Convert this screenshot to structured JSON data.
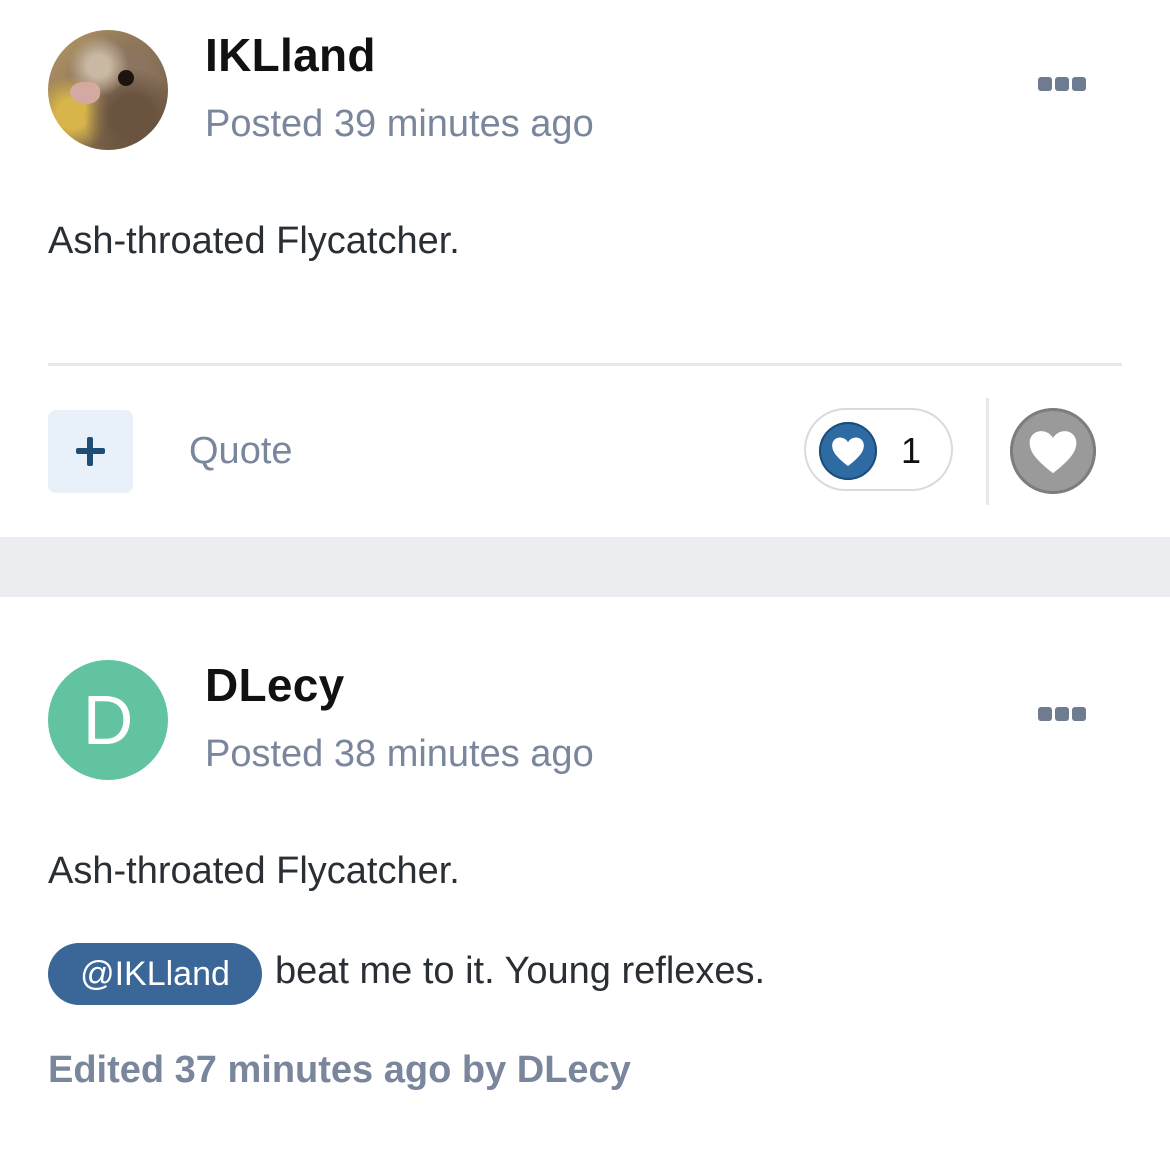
{
  "colors": {
    "accent": "#2d6ba2",
    "mention_bg": "#3a6797",
    "meta_text": "#7a869c",
    "avatar_letter_bg": "#62c3a0",
    "separator_bg": "#ebedf1"
  },
  "posts": [
    {
      "author": "IKLland",
      "posted": "Posted 39 minutes ago",
      "body": "Ash-throated Flycatcher.",
      "more_icon": "ellipsis-icon",
      "actions": {
        "add_icon": "plus-icon",
        "quote_label": "Quote",
        "reaction_icon": "heart-icon",
        "reaction_count": "1",
        "like_icon": "heart-outline-icon"
      }
    },
    {
      "author": "DLecy",
      "avatar_letter": "D",
      "posted": "Posted 38 minutes ago",
      "body": "Ash-throated Flycatcher.",
      "mention": "@IKLland",
      "mention_text": "beat me to it. Young reflexes.",
      "edited": "Edited 37 minutes ago by DLecy",
      "more_icon": "ellipsis-icon"
    }
  ]
}
